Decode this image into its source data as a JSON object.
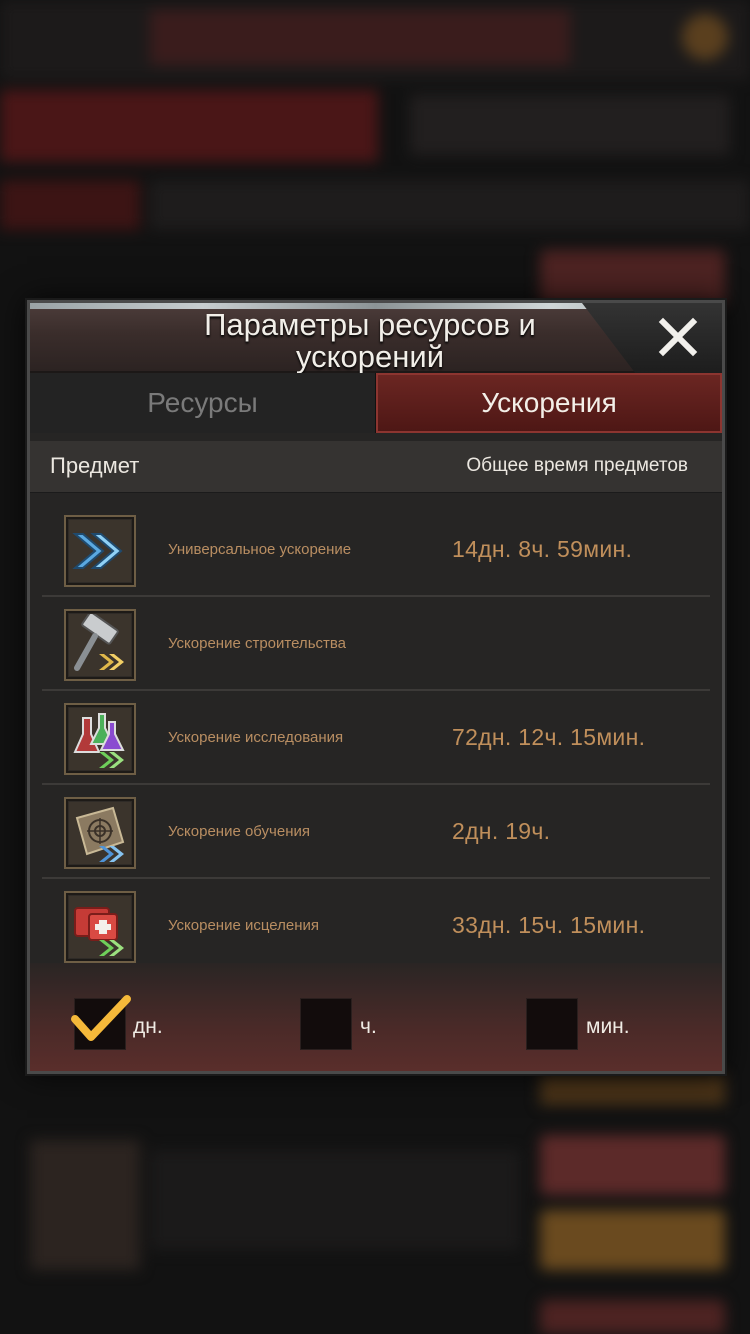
{
  "dialog": {
    "title": "Параметры ресурсов и ускорений",
    "close_icon": "close-icon"
  },
  "tabs": [
    {
      "label": "Ресурсы",
      "active": false
    },
    {
      "label": "Ускорения",
      "active": true
    }
  ],
  "columns": {
    "item": "Предмет",
    "total_time": "Общее время предметов"
  },
  "items": [
    {
      "icon": "double-chevron-icon",
      "name": "Универсальное ускорение",
      "time": "14дн. 8ч. 59мин."
    },
    {
      "icon": "hammer-icon",
      "name": "Ускорение строительства",
      "time": ""
    },
    {
      "icon": "flasks-icon",
      "name": "Ускорение исследования",
      "time": "72дн. 12ч. 15мин."
    },
    {
      "icon": "target-board-icon",
      "name": "Ускорение обучения",
      "time": "2дн. 19ч."
    },
    {
      "icon": "medkit-icon",
      "name": "Ускорение исцеления",
      "time": "33дн. 15ч. 15мин."
    }
  ],
  "filters": [
    {
      "label": "дн.",
      "checked": true
    },
    {
      "label": "ч.",
      "checked": false
    },
    {
      "label": "мин.",
      "checked": false
    }
  ],
  "colors": {
    "accent_red": "#6b2622",
    "time_text": "#c08f5b",
    "check": "#f5b93a"
  }
}
